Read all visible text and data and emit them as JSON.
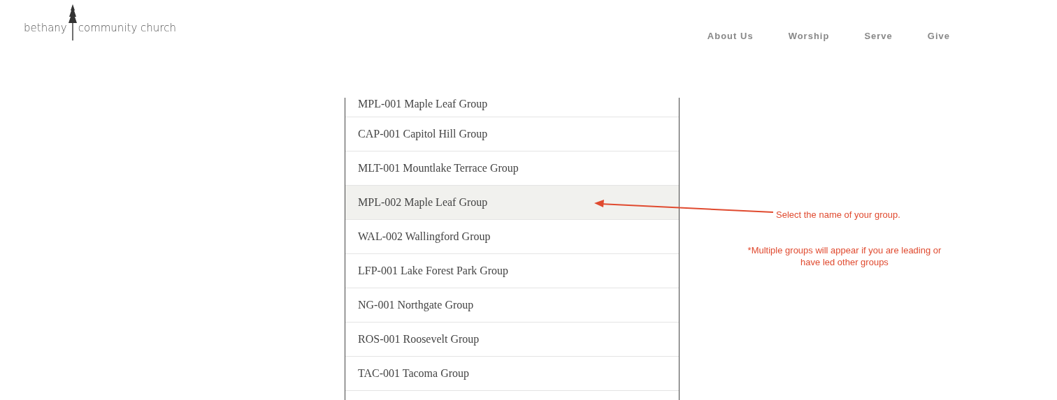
{
  "header": {
    "logo": {
      "left": "bethany",
      "right": "community church"
    },
    "nav": [
      {
        "label": "About Us"
      },
      {
        "label": "Worship"
      },
      {
        "label": "Serve"
      },
      {
        "label": "Give"
      }
    ]
  },
  "groups": [
    {
      "label": "MPL-001 Maple Leaf Group",
      "selected": false
    },
    {
      "label": "CAP-001 Capitol Hill Group",
      "selected": false
    },
    {
      "label": "MLT-001 Mountlake Terrace Group",
      "selected": false
    },
    {
      "label": "MPL-002 Maple Leaf Group",
      "selected": true
    },
    {
      "label": "WAL-002 Wallingford Group",
      "selected": false
    },
    {
      "label": "LFP-001 Lake Forest Park Group",
      "selected": false
    },
    {
      "label": "NG-001 Northgate Group",
      "selected": false
    },
    {
      "label": "ROS-001 Roosevelt Group",
      "selected": false
    },
    {
      "label": "TAC-001 Tacoma Group",
      "selected": false
    }
  ],
  "annotations": {
    "instruction": "Select the name of your group.",
    "note": "*Multiple groups will appear if you are leading or have led other groups"
  }
}
